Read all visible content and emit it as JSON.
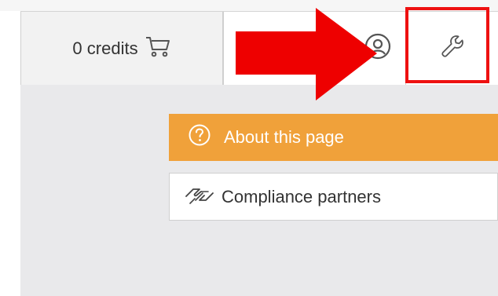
{
  "toolbar": {
    "credits_label": "0 credits",
    "cart_icon": "cart-icon",
    "user_icon": "user-circle-icon",
    "tools_icon": "wrench-icon"
  },
  "menu": {
    "items": [
      {
        "label": "About this page",
        "icon": "question-circle-icon"
      },
      {
        "label": "Compliance partners",
        "icon": "handshake-icon"
      }
    ]
  },
  "annotation": {
    "arrow_color": "#ee0000",
    "highlight_color": "#ee1111"
  },
  "colors": {
    "accent": "#f0a13a",
    "content_bg": "#e9e9eb"
  }
}
